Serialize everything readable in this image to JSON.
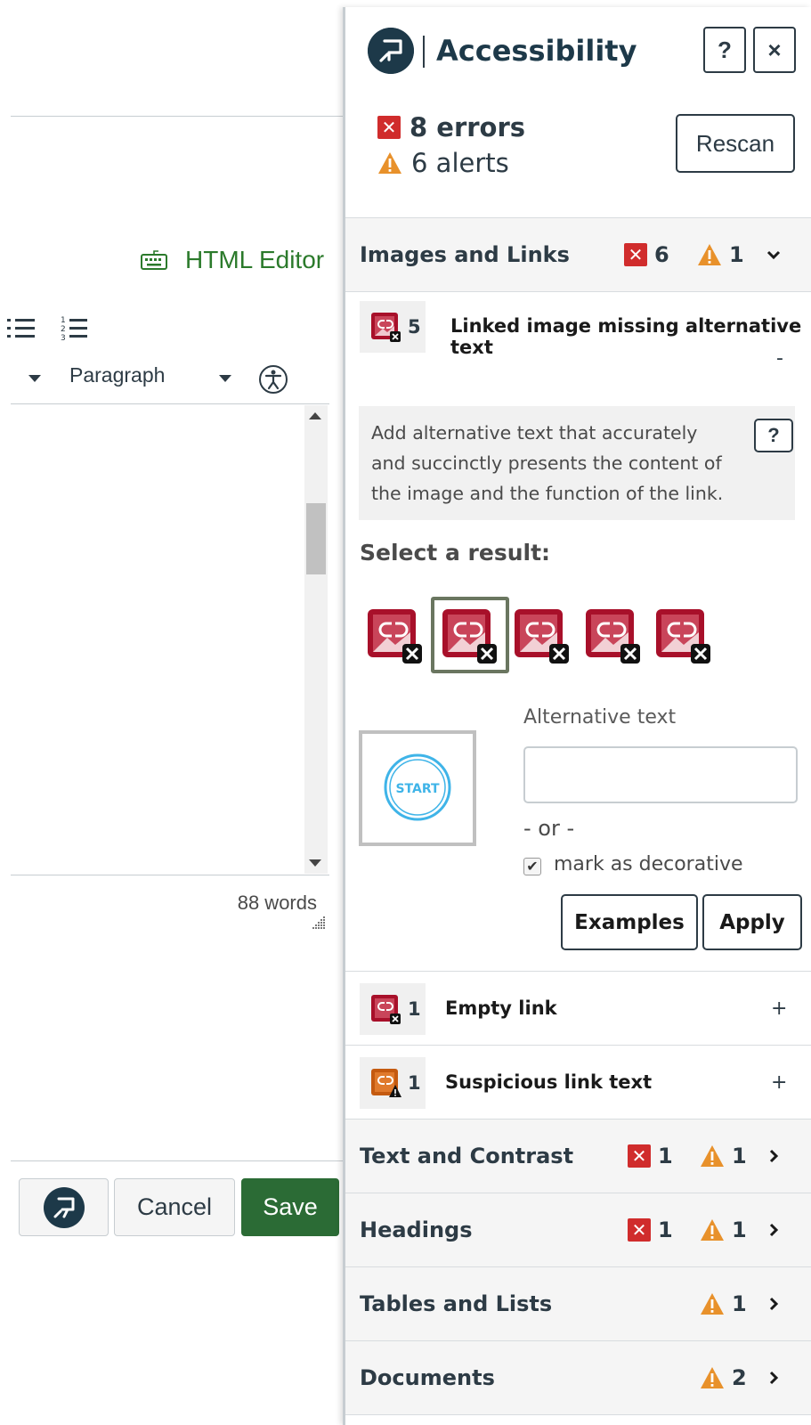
{
  "editor": {
    "html_editor_label": "HTML Editor",
    "paragraph_label": "Paragraph",
    "word_count": "88 words",
    "cancel_label": "Cancel",
    "save_label": "Save"
  },
  "panel": {
    "title": "Accessibility",
    "help_label": "?",
    "close_label": "×",
    "errors_summary": "8 errors",
    "alerts_summary": "6 alerts",
    "rescan_label": "Rescan",
    "sections": [
      {
        "title": "Images and Links",
        "errors": "6",
        "alerts": "1",
        "expanded": true
      },
      {
        "title": "Text and Contrast",
        "errors": "1",
        "alerts": "1",
        "expanded": false
      },
      {
        "title": "Headings",
        "errors": "1",
        "alerts": "1",
        "expanded": false
      },
      {
        "title": "Tables and Lists",
        "errors": "",
        "alerts": "1",
        "expanded": false
      },
      {
        "title": "Documents",
        "errors": "",
        "alerts": "2",
        "expanded": false
      }
    ],
    "issues": [
      {
        "count": "5",
        "label": "Linked image missing alternative text",
        "toggle": "-",
        "severity": "error"
      },
      {
        "count": "1",
        "label": "Empty link",
        "toggle": "+",
        "severity": "error"
      },
      {
        "count": "1",
        "label": "Suspicious link text",
        "toggle": "+",
        "severity": "alert"
      }
    ],
    "rule_help": "Add alternative text that accurately and succinctly presents the content of the image and the function of the link.",
    "rule_help_button": "?",
    "select_result_label": "Select a result:",
    "selected_result_index": 2,
    "result_count": 5,
    "preview_image_text": "START",
    "alt_text_label": "Alternative text",
    "alt_text_value": "",
    "or_label": "- or -",
    "decorative_label": "mark as decorative",
    "decorative_checked": true,
    "examples_label": "Examples",
    "apply_label": "Apply"
  },
  "colors": {
    "error": "#d02c2c",
    "alert": "#e8912b",
    "save_green": "#2b6b35",
    "html_editor_green": "#2b7a2b",
    "brand_navy": "#1d3949",
    "image_link_red": "#a8102a"
  }
}
